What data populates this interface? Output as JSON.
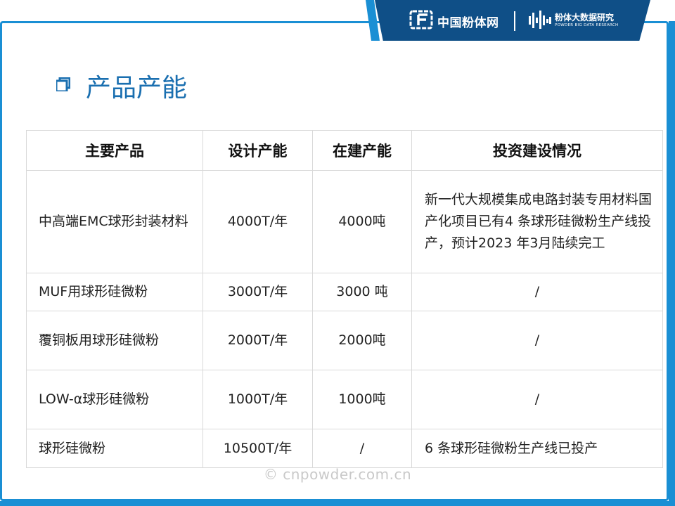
{
  "header": {
    "brand_name": "中国粉体网",
    "research_name": "粉体大数据研究",
    "research_en": "POWDER BIG DATA RESEARCH"
  },
  "page_title": "产品产能",
  "table": {
    "headers": [
      "主要产品",
      "设计产能",
      "在建产能",
      "投资建设情况"
    ],
    "rows": [
      {
        "product": "中高端EMC球形封装材料",
        "design": "4000T/年",
        "building": "4000吨",
        "investment": "新一代大规模集成电路封装专用材料国产化项目已有4 条球形硅微粉生产线投产，预计2023 年3月陆续完工"
      },
      {
        "product": "MUF用球形硅微粉",
        "design": "3000T/年",
        "building": "3000 吨",
        "investment": "/"
      },
      {
        "product": "覆铜板用球形硅微粉",
        "design": "2000T/年",
        "building": "2000吨",
        "investment": "/"
      },
      {
        "product": "LOW-α球形硅微粉",
        "design": "1000T/年",
        "building": "1000吨",
        "investment": "/"
      },
      {
        "product": "球形硅微粉",
        "design": "10500T/年",
        "building": "/",
        "investment": "6 条球形硅微粉生产线已投产"
      }
    ]
  },
  "watermark": "© cnpowder.com.cn",
  "colors": {
    "frame_blue": "#1a8fd4",
    "header_navy": "#0f4f87",
    "title_blue": "#1a6fb0",
    "grid": "#d9d9d9"
  },
  "icons": [
    "brand-logo-icon",
    "research-logo-icon",
    "title-square-icon"
  ]
}
